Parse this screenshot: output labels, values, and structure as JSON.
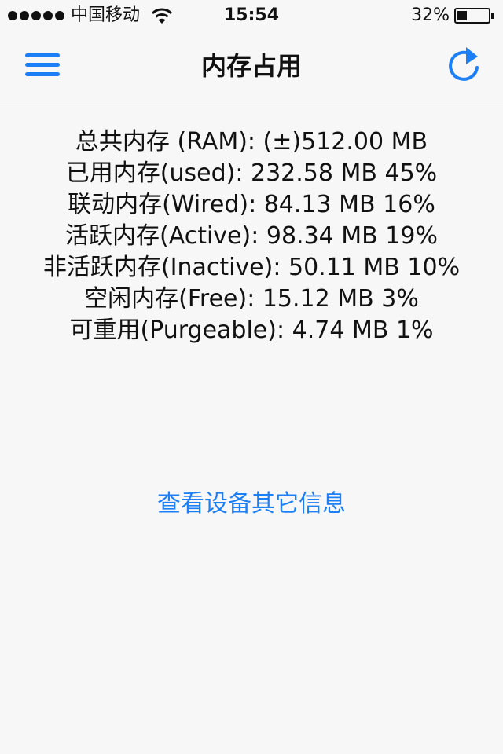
{
  "status_bar": {
    "carrier": "中国移动",
    "time": "15:54",
    "battery_percent": "32%",
    "signal_bars": 5,
    "battery_level": 0.32
  },
  "nav": {
    "title": "内存占用",
    "left_icon": "menu-icon",
    "right_icon": "refresh-icon"
  },
  "memory": {
    "lines": [
      "总共内存 (RAM): (±)512.00 MB",
      "已用内存(used): 232.58 MB 45%",
      "联动内存(Wired): 84.13 MB 16%",
      "活跃内存(Active): 98.34 MB 19%",
      "非活跃内存(Inactive): 50.11 MB 10%",
      "空闲内存(Free): 15.12 MB 3%",
      "可重用(Purgeable): 4.74 MB 1%"
    ]
  },
  "link": {
    "label": "查看设备其它信息"
  },
  "colors": {
    "accent": "#1d7ff5",
    "background": "#f7f7f7",
    "text": "#111111"
  }
}
